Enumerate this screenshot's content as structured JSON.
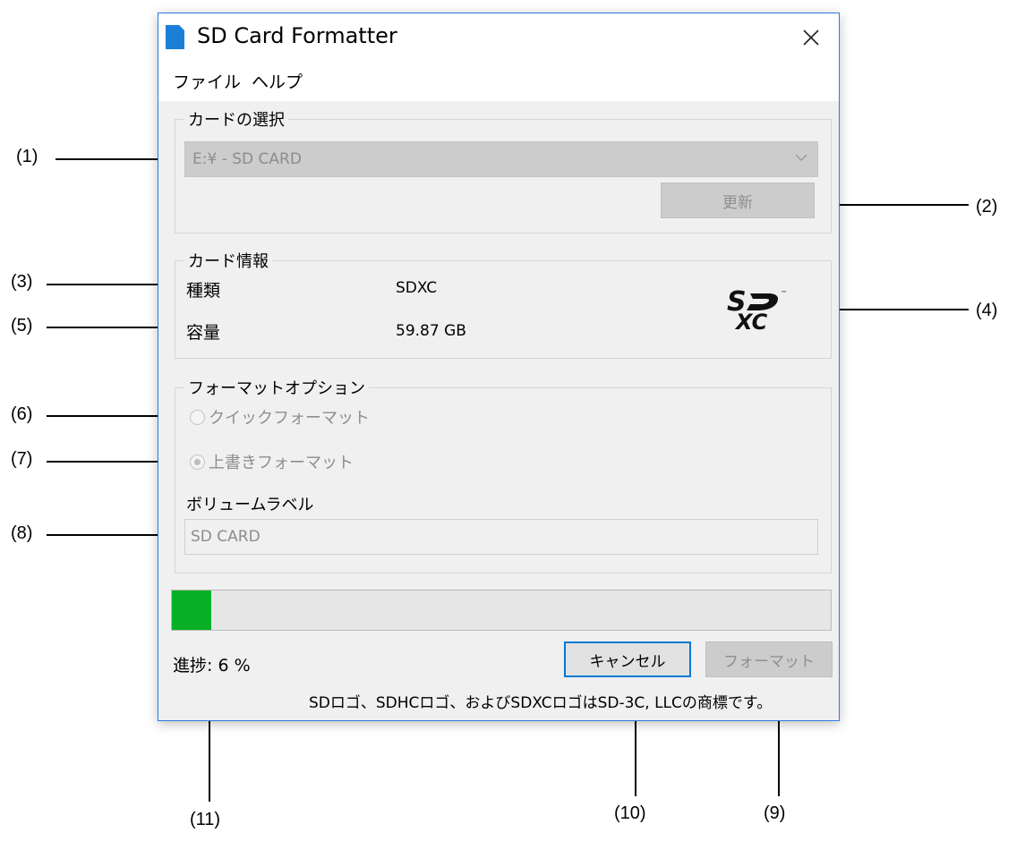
{
  "window": {
    "title": "SD Card Formatter",
    "menu": [
      "ファイル",
      "ヘルプ"
    ]
  },
  "card_selection": {
    "group_label": "カードの選択",
    "drive_value": "E:¥ - SD CARD",
    "refresh_label": "更新"
  },
  "card_info": {
    "group_label": "カード情報",
    "type_label": "種類",
    "type_value": "SDXC",
    "capacity_label": "容量",
    "capacity_value": "59.87 GB",
    "logo_icon": "sdxc-logo"
  },
  "format_options": {
    "group_label": "フォーマットオプション",
    "quick_label": "クイックフォーマット",
    "overwrite_label": "上書きフォーマット",
    "selected": "overwrite",
    "volume_label_caption": "ボリュームラベル",
    "volume_label_value": "SD CARD"
  },
  "progress": {
    "fraction": 0.06,
    "status_text": "進捗: 6 %",
    "fill_color": "#06b025"
  },
  "buttons": {
    "cancel_label": "キャンセル",
    "format_label": "フォーマット"
  },
  "footer_note": "SDロゴ、SDHCロゴ、およびSDXCロゴはSD-3C, LLCの商標です。",
  "callouts": [
    "(1)",
    "(2)",
    "(3)",
    "(4)",
    "(5)",
    "(6)",
    "(7)",
    "(8)",
    "(9)",
    "(10)",
    "(11)"
  ]
}
